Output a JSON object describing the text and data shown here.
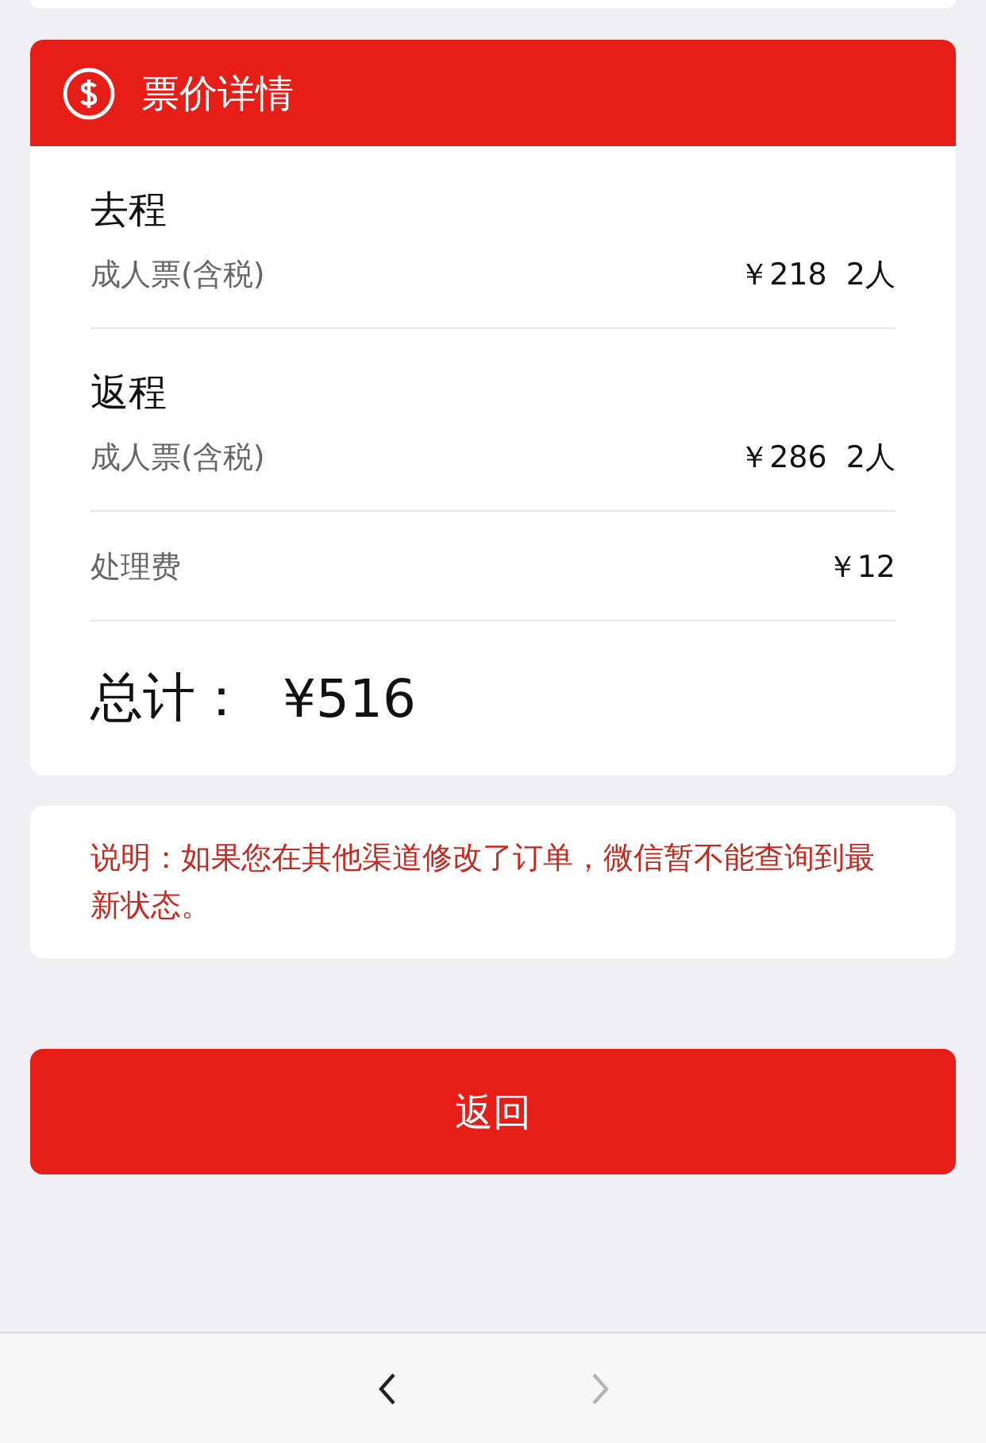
{
  "fare_card": {
    "title": "票价详情",
    "legs": [
      {
        "title": "去程",
        "rows": [
          {
            "label": "成人票(含税)",
            "value": "￥218  2人"
          }
        ]
      },
      {
        "title": "返程",
        "rows": [
          {
            "label": "成人票(含税)",
            "value": "￥286  2人"
          }
        ]
      }
    ],
    "fees": [
      {
        "label": "处理费",
        "value": "￥12"
      }
    ],
    "total_label": "总计：",
    "total_value": "¥516"
  },
  "notice": "说明：如果您在其他渠道修改了订单，微信暂不能查询到最新状态。",
  "return_button": "返回",
  "browser_nav": {
    "back_disabled": false,
    "forward_disabled": true
  }
}
